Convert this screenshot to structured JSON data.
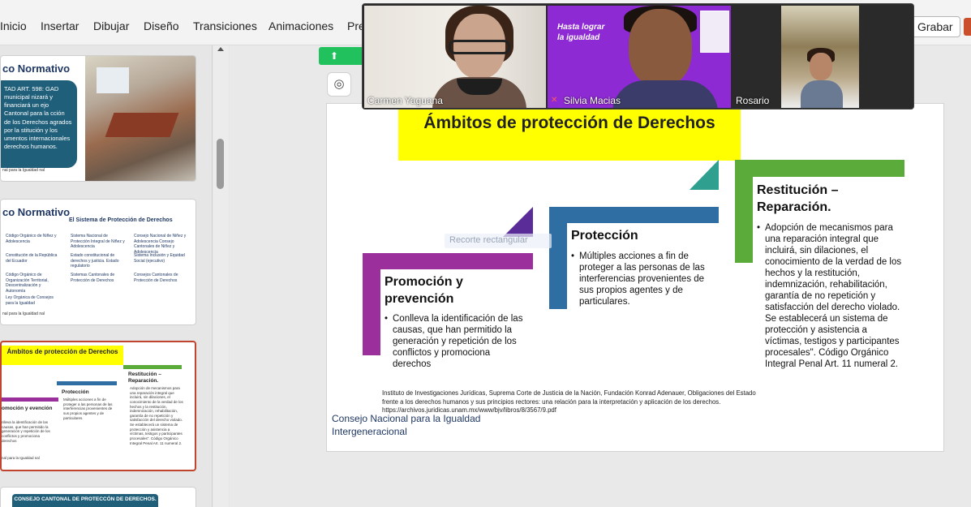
{
  "ribbon": {
    "menu": [
      "Inicio",
      "Insertar",
      "Dibujar",
      "Diseño",
      "Transiciones",
      "Animaciones",
      "Pre"
    ],
    "record_label": "Grabar"
  },
  "thumbnails": [
    {
      "title": "co Normativo",
      "box_text": "TAD ART. 598: GAD municipal nizará y financiará un ejo Cantonal para la cción de los Derechos agrados por la stitución y los umentos internacionales derechos humanos.",
      "footer": "nal para la Igualdad nal"
    },
    {
      "title": "co Normativo",
      "subtitle": "El Sistema de Protección de Derechos",
      "cells": [
        "Código Orgánico de Niñez y Adolescencia",
        "Sistema Nacional de Protección Integral de Niñez y Adolescencia",
        "Consejo Nacional de Niñez y Adolescencia Consejo Cantonales de Niñez y Adolescencia",
        "Constitución de la República del Ecuador",
        "Estado constitucional de derechos y justicia. Estado regulatorio",
        "Sistema Inclusión y Equidad Social (ejecutivo)",
        "Código Orgánico de Organización Territorial, Descentralización y Autonomía",
        "Sistemas Cantonales de Protección de Derechos",
        "Consejos Cantonales de Protección de Derechos",
        "Ley Orgánica de Consejos para la Igualdad"
      ],
      "footer": "nal para la Igualdad nal"
    },
    {
      "title": "Ámbitos de protección de Derechos",
      "col1_head": "omoción y evención",
      "col1_text": "nlleva la identificación de las causas, que han permitido la generación y repetición de los conflictos y promociona derechos",
      "col2_head": "Protección",
      "col2_text": "Múltiples acciones a fin de proteger a las personas de las interferencias provenientes de sus propios agentes y de particulares.",
      "col3_head": "Restitución – Reparación.",
      "col3_text": "Adopción de mecanismos para una reparación integral que incluirá, sin dilaciones, el conocimiento de la verdad de los hechos y la restitución, indemnización, rehabilitación, garantía de no repetición y satisfacción del derecho violado. Se establecerá un sistema de protección y asistencia a víctimas, testigos y participantes procesales\". Código Orgánico Integral Penal Art. 11 numeral 2.",
      "footer": "nal para la Igualdad nal"
    },
    {
      "box_text": "CONSEJO CANTONAL DE PROTECCÓN DE DERECHOS."
    }
  ],
  "slide": {
    "title": "Ámbitos de protección de Derechos",
    "col1": {
      "head": "Promoción y prevención",
      "bullet": "Conlleva la identificación de las causas, que han  permitido la generación y repetición de los conflictos y promociona derechos"
    },
    "col2": {
      "head": "Protección",
      "bullet": "Múltiples acciones a fin de proteger a las personas de las interferencias provenientes de sus propios agentes y de particulares."
    },
    "col3": {
      "head": "Restitución – Reparación.",
      "bullet": "Adopción de mecanismos para una reparación integral que incluirá, sin dilaciones, el conocimiento de la verdad de los hechos y la restitución, indemnización, rehabilitación, garantía de no repetición y satisfacción del derecho violado. Se establecerá un sistema de protección y asistencia a víctimas, testigos y participantes procesales\". Código Orgánico Integral Penal Art. 11 numeral 2."
    },
    "citation": "Instituto de Investigaciones Jurídicas, Suprema Corte de Justicia de la Nación, Fundación Konrad Adenauer, Obligaciones del Estado  frente a los derechos humanos y sus principios rectores: una relación para la interpretación y  aplicación de los derechos. https://archivos.juridicas.unam.mx/www/bjv/libros/8/3567/9.pdf",
    "org_line1": "Consejo Nacional para la Igualdad",
    "org_line2": "Intergeneracional"
  },
  "tooltip": "Recorte rectangular",
  "video": {
    "participants": [
      "Carmen Yaguana",
      "Silvia Macias",
      "Rosario"
    ],
    "background_text": "Hasta lograr la igualdad"
  },
  "colors": {
    "purple": "#9b2f9b",
    "blue": "#2f6ea3",
    "green": "#5aab3a",
    "yellow": "#ffff00",
    "active_border": "#c0452e"
  }
}
